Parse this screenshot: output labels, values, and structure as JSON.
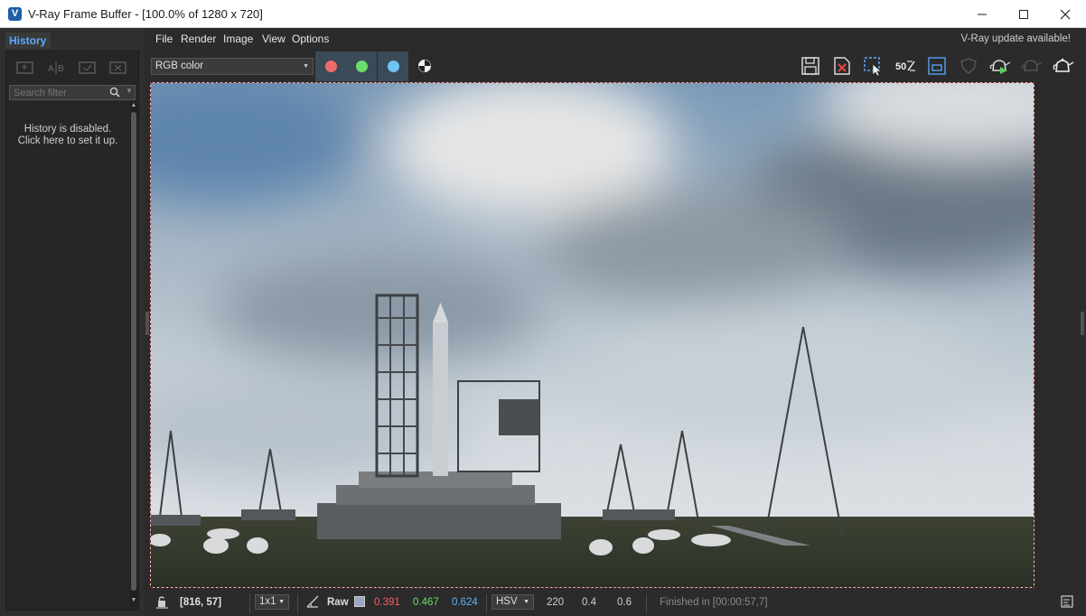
{
  "window": {
    "title": "V-Ray Frame Buffer - [100.0% of 1280 x 720]",
    "logo_letter": "V"
  },
  "history": {
    "tab_label": "History",
    "search_placeholder": "Search filter",
    "disabled_line1": "History is disabled.",
    "disabled_line2": "Click here to set it up."
  },
  "menu": {
    "items": [
      "File",
      "Render",
      "Image",
      "View",
      "Options"
    ],
    "update_note": "V-Ray update available!"
  },
  "toolbar": {
    "channel_value": "RGB color",
    "channel_colors": {
      "red": "#ef6b6b",
      "green": "#6ddc6d",
      "blue": "#6ec4f2"
    },
    "region_value_label": "50"
  },
  "status": {
    "coords": "[816, 57]",
    "sample_size": "1x1",
    "raw_label": "Raw",
    "raw_swatch": "#9aa6c4",
    "r": "0.391",
    "g": "0.467",
    "b": "0.624",
    "color_space": "HSV",
    "h": "220",
    "s": "0.4",
    "v": "0.6",
    "finished": "Finished in [00:00:57,7]"
  },
  "colors": {
    "accent": "#5aa9ff",
    "r_text": "#ff5b5b",
    "g_text": "#6ddc6d",
    "b_text": "#5ab4ff"
  }
}
